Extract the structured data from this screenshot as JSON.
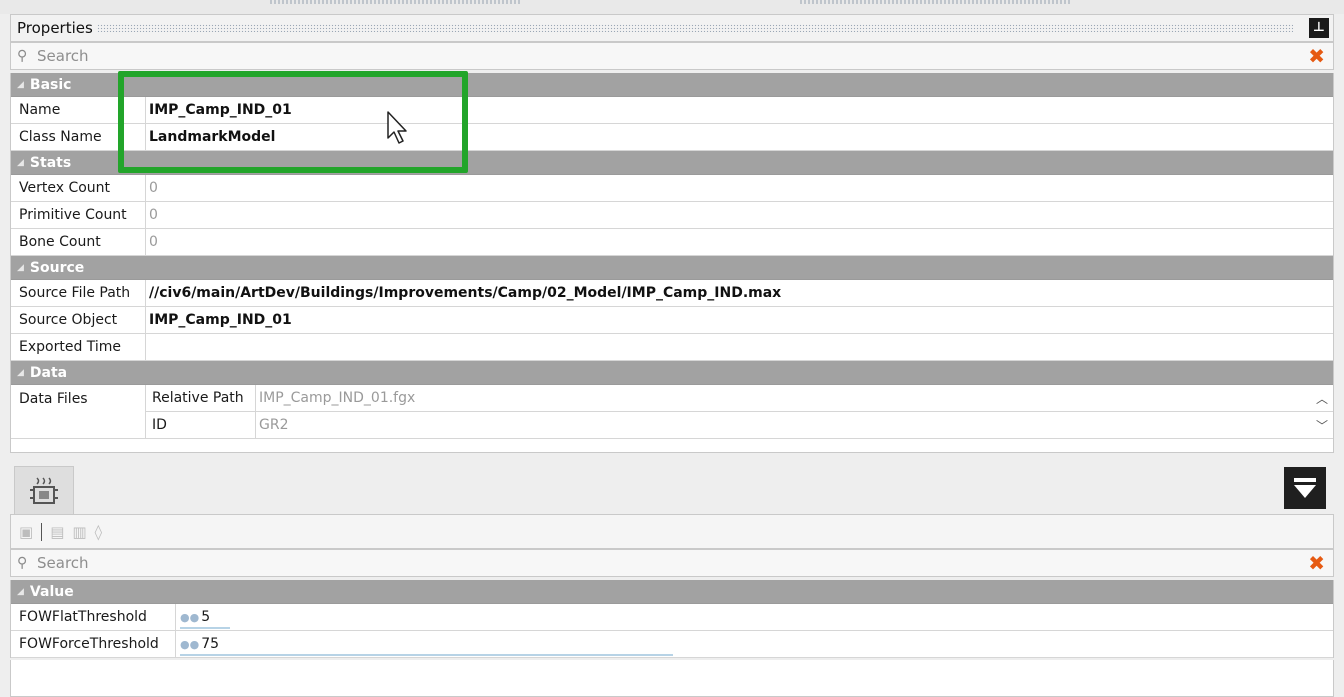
{
  "properties_panel": {
    "title": "Properties",
    "pin_label": "Ⓟ",
    "search_placeholder": "Search"
  },
  "basic": {
    "header": "Basic",
    "rows": [
      {
        "key": "Name",
        "value": "IMP_Camp_IND_01"
      },
      {
        "key": "Class Name",
        "value": "LandmarkModel"
      }
    ]
  },
  "stats": {
    "header": "Stats",
    "rows": [
      {
        "key": "Vertex Count",
        "value": "0"
      },
      {
        "key": "Primitive Count",
        "value": "0"
      },
      {
        "key": "Bone Count",
        "value": "0"
      }
    ]
  },
  "source": {
    "header": "Source",
    "rows": [
      {
        "key": "Source File Path",
        "value": "//civ6/main/ArtDev/Buildings/Improvements/Camp/02_Model/IMP_Camp_IND.max"
      },
      {
        "key": "Source Object",
        "value": "IMP_Camp_IND_01"
      },
      {
        "key": "Exported Time",
        "value": ""
      }
    ]
  },
  "data": {
    "header": "Data",
    "data_files_label": "Data Files",
    "subrows": [
      {
        "key": "Relative Path",
        "value": "IMP_Camp_IND_01.fgx"
      },
      {
        "key": "ID",
        "value": "GR2"
      }
    ]
  },
  "lower_panel": {
    "search_placeholder": "Search",
    "value_header": "Value",
    "rows": [
      {
        "key": "FOWFlatThreshold",
        "value": "5",
        "slider_fraction": 0.09
      },
      {
        "key": "FOWForceThreshold",
        "value": "75",
        "slider_fraction": 0.88
      }
    ]
  },
  "colors": {
    "highlight": "#22a52a",
    "category_bar": "#a2a2a2",
    "clear_icon": "#e65a12"
  }
}
